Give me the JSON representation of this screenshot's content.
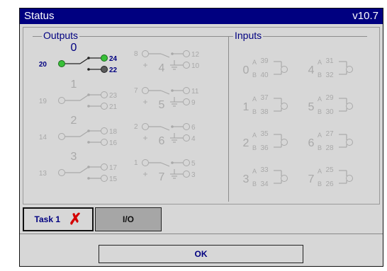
{
  "window": {
    "title": "Status",
    "version": "v10.7"
  },
  "outputs": {
    "title": "Outputs",
    "items": [
      {
        "num": "0",
        "common": "20",
        "nc": "22",
        "no": "24",
        "active": true
      },
      {
        "num": "1",
        "common": "19",
        "nc": "21",
        "no": "23",
        "active": false
      },
      {
        "num": "2",
        "common": "14",
        "nc": "16",
        "no": "18",
        "active": false
      },
      {
        "num": "3",
        "common": "13",
        "nc": "15",
        "no": "17",
        "active": false
      },
      {
        "num": "4",
        "common": "8",
        "plus": "+",
        "no": "12",
        "nc": "10"
      },
      {
        "num": "5",
        "common": "7",
        "plus": "+",
        "no": "11",
        "nc": "9"
      },
      {
        "num": "6",
        "common": "2",
        "plus": "+",
        "no": "6",
        "nc": "4"
      },
      {
        "num": "7",
        "common": "1",
        "plus": "+",
        "no": "5",
        "nc": "3"
      }
    ]
  },
  "inputs": {
    "title": "Inputs",
    "items": [
      {
        "num": "0",
        "a_label": "A",
        "b_label": "B",
        "a": "39",
        "b": "40"
      },
      {
        "num": "1",
        "a_label": "A",
        "b_label": "B",
        "a": "37",
        "b": "38"
      },
      {
        "num": "2",
        "a_label": "A",
        "b_label": "B",
        "a": "35",
        "b": "36"
      },
      {
        "num": "3",
        "a_label": "A",
        "b_label": "B",
        "a": "33",
        "b": "34"
      },
      {
        "num": "4",
        "a_label": "A",
        "b_label": "B",
        "a": "31",
        "b": "32"
      },
      {
        "num": "5",
        "a_label": "A",
        "b_label": "B",
        "a": "29",
        "b": "30"
      },
      {
        "num": "6",
        "a_label": "A",
        "b_label": "B",
        "a": "27",
        "b": "28"
      },
      {
        "num": "7",
        "a_label": "A",
        "b_label": "B",
        "a": "25",
        "b": "26"
      }
    ]
  },
  "tabs": [
    {
      "label": "Task 1",
      "status_icon": "error-x-icon"
    },
    {
      "label": "I/O"
    }
  ],
  "ok_label": "OK",
  "colors": {
    "title_bg": "#000080",
    "active_text": "#000080",
    "inactive": "#a9a9a9",
    "led_on": "#38c038",
    "led_off": "#5a5a5a",
    "error": "#d40000"
  }
}
